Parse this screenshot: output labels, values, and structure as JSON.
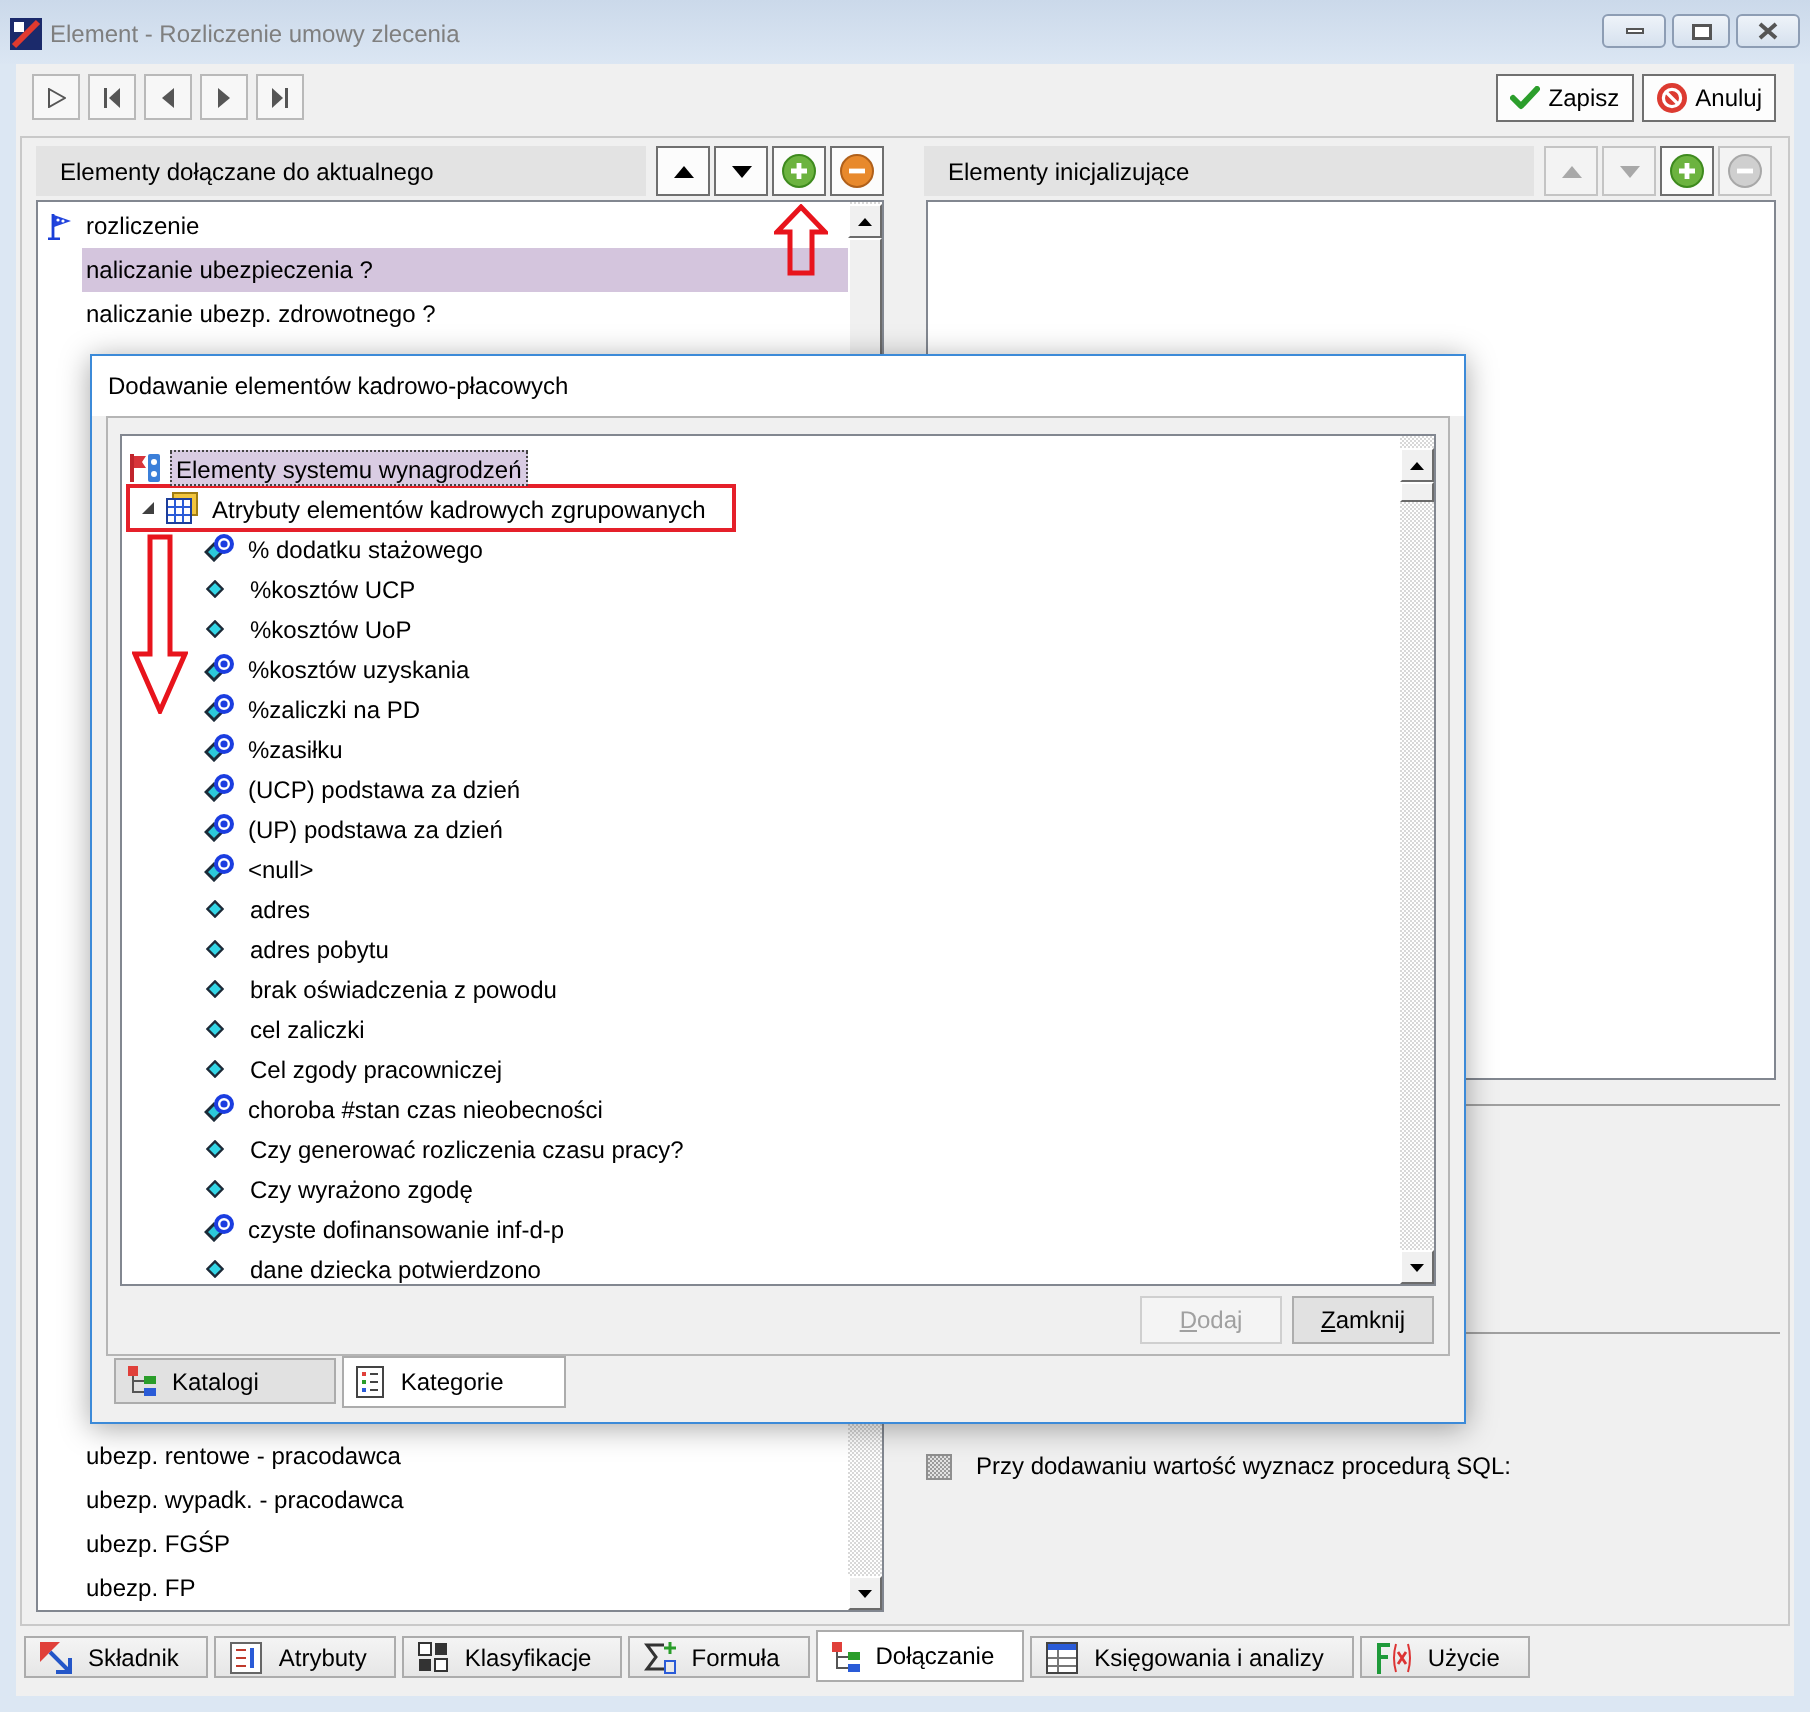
{
  "window": {
    "title": "Element - Rozliczenie umowy zlecenia"
  },
  "toolbar": {
    "nav_buttons": [
      {
        "kind": "play"
      },
      {
        "kind": "first"
      },
      {
        "kind": "prev"
      },
      {
        "kind": "next"
      },
      {
        "kind": "last"
      }
    ],
    "actions": [
      {
        "kind": "save",
        "label": "Zapisz"
      },
      {
        "kind": "cancel",
        "label": "Anuluj"
      }
    ]
  },
  "left_pane": {
    "title": "Elementy dołączane do aktualnego",
    "buttons": [
      {
        "kind": "up",
        "disabled": false
      },
      {
        "kind": "down",
        "disabled": false
      },
      {
        "kind": "add",
        "disabled": false
      },
      {
        "kind": "remove",
        "disabled": false
      }
    ],
    "items_top": [
      {
        "kind": "flag",
        "label": "rozliczenie",
        "selected": false
      },
      {
        "kind": "plain",
        "label": "naliczanie ubezpieczenia ?",
        "selected": true
      },
      {
        "kind": "plain",
        "label": "naliczanie ubezp. zdrowotnego ?",
        "selected": false
      }
    ],
    "items_bottom": [
      {
        "label": "ubezp. rentowe - pracodawca",
        "selected": false
      },
      {
        "label": "ubezp. wypadk. - pracodawca",
        "selected": false
      },
      {
        "label": "ubezp. FGŚP",
        "selected": false
      },
      {
        "label": "ubezp. FP",
        "selected": false
      }
    ]
  },
  "right_pane": {
    "title": "Elementy inicjalizujące",
    "buttons": [
      {
        "kind": "up",
        "disabled": true
      },
      {
        "kind": "down",
        "disabled": true
      },
      {
        "kind": "add",
        "disabled": false
      },
      {
        "kind": "remove",
        "disabled": true
      }
    ],
    "options": [
      {
        "label": "Przy dodawaniu wartość wyznacz procedurą SQL:",
        "indeterminate": true
      }
    ]
  },
  "tabs": [
    {
      "kind": "component",
      "label": "Składnik",
      "selected": false
    },
    {
      "kind": "attributes",
      "label": "Atrybuty",
      "selected": false
    },
    {
      "kind": "classification",
      "label": "Klasyfikacje",
      "selected": false
    },
    {
      "kind": "formula",
      "label": "Formuła",
      "selected": false
    },
    {
      "kind": "attach",
      "label": "Dołączanie",
      "selected": true
    },
    {
      "kind": "accounting",
      "label": "Księgowania i analizy",
      "selected": false
    },
    {
      "kind": "usage",
      "label": "Użycie",
      "selected": false
    }
  ],
  "dialog": {
    "title": "Dodawanie elementów kadrowo-płacowych",
    "tree": {
      "nodes": [
        {
          "kind": "system",
          "label": "Elementy systemu wynagrodzeń",
          "selected": true,
          "children": [
            {
              "kind": "group",
              "label": "Atrybuty elementów kadrowych zgrupowanych",
              "selected": false,
              "expanded": true,
              "marked": true,
              "children": [
                {
                  "kind": "ring",
                  "label": "% dodatku stażowego",
                  "selected": false
                },
                {
                  "kind": "diamond",
                  "label": "%kosztów UCP",
                  "selected": false
                },
                {
                  "kind": "diamond",
                  "label": "%kosztów UoP",
                  "selected": false
                },
                {
                  "kind": "ring",
                  "label": "%kosztów uzyskania",
                  "selected": false
                },
                {
                  "kind": "ring",
                  "label": "%zaliczki na PD",
                  "selected": false
                },
                {
                  "kind": "ring",
                  "label": "%zasiłku",
                  "selected": false
                },
                {
                  "kind": "ring",
                  "label": "(UCP) podstawa za dzień",
                  "selected": false
                },
                {
                  "kind": "ring",
                  "label": "(UP) podstawa za dzień",
                  "selected": false
                },
                {
                  "kind": "ring",
                  "label": "<null>",
                  "selected": false
                },
                {
                  "kind": "diamond",
                  "label": "adres",
                  "selected": false
                },
                {
                  "kind": "diamond",
                  "label": "adres pobytu",
                  "selected": false
                },
                {
                  "kind": "diamond",
                  "label": "brak oświadczenia z powodu",
                  "selected": false
                },
                {
                  "kind": "diamond",
                  "label": "cel zaliczki",
                  "selected": false
                },
                {
                  "kind": "diamond",
                  "label": "Cel zgody pracowniczej",
                  "selected": false
                },
                {
                  "kind": "ring",
                  "label": "choroba #stan czas nieobecności",
                  "selected": false
                },
                {
                  "kind": "diamond",
                  "label": "Czy generować rozliczenia czasu pracy?",
                  "selected": false
                },
                {
                  "kind": "diamond",
                  "label": "Czy wyrażono zgodę",
                  "selected": false
                },
                {
                  "kind": "ring",
                  "label": "czyste dofinansowanie inf-d-p",
                  "selected": false
                },
                {
                  "kind": "diamond",
                  "label": "dane dziecka potwierdzono",
                  "selected": false
                }
              ]
            }
          ]
        }
      ]
    },
    "buttons": [
      {
        "label": "Dodaj",
        "disabled": true
      },
      {
        "label": "Zamknij",
        "disabled": false
      }
    ],
    "tabs": [
      {
        "kind": "catalogs",
        "label": "Katalogi",
        "selected": false
      },
      {
        "kind": "categories",
        "label": "Kategorie",
        "selected": true
      }
    ]
  }
}
